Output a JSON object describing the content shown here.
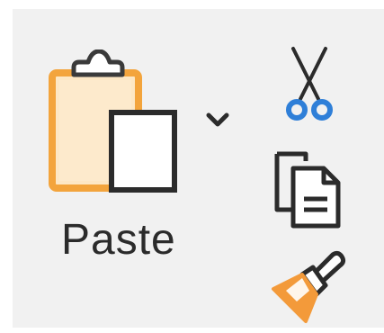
{
  "clipboard": {
    "paste_label": "Paste",
    "icons": {
      "paste": "clipboard-paste-icon",
      "dropdown": "chevron-down-icon",
      "cut": "scissors-icon",
      "copy": "copy-icon",
      "format_painter": "paintbrush-icon"
    },
    "colors": {
      "clipboard_orange": "#f3a43c",
      "clipboard_fill": "#fde7c4",
      "scissors_blue": "#2f7fd8",
      "brush_orange": "#f39a3a",
      "ink": "#2b2b2b"
    }
  }
}
